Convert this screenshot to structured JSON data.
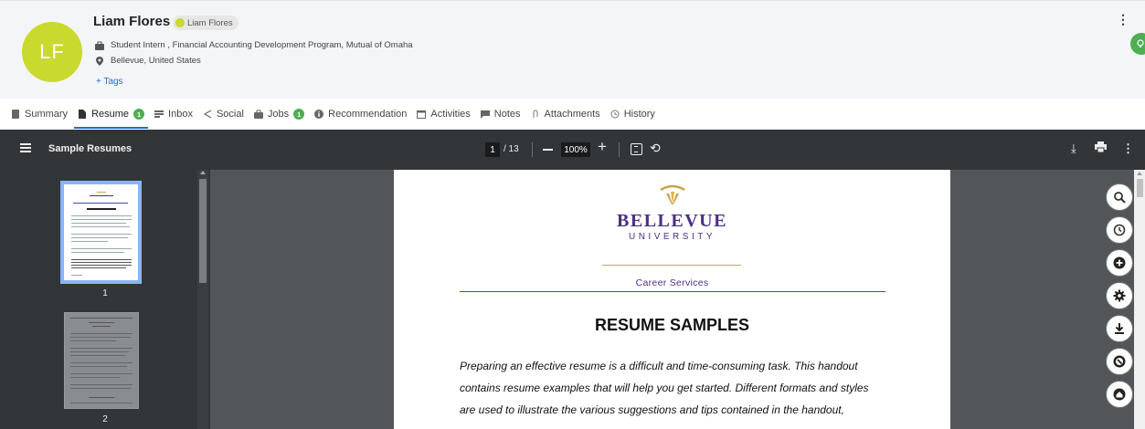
{
  "profile": {
    "initials": "LF",
    "name": "Liam Flores",
    "chip_label": "Liam Flores",
    "position": "Student Intern , Financial Accounting Development Program, Mutual of Omaha",
    "location": "Bellevue, United States",
    "tags_label": "+ Tags",
    "more_menu": "⋮",
    "avatar_color": "#c9d92e"
  },
  "tabs": [
    {
      "label": "Summary",
      "icon": "document-icon"
    },
    {
      "label": "Resume",
      "icon": "file-icon",
      "badge": "1",
      "active": true
    },
    {
      "label": "Inbox",
      "icon": "inbox-icon"
    },
    {
      "label": "Social",
      "icon": "share-icon"
    },
    {
      "label": "Jobs",
      "icon": "briefcase-icon",
      "badge": "1"
    },
    {
      "label": "Recommendation",
      "icon": "info-icon"
    },
    {
      "label": "Activities",
      "icon": "calendar-icon"
    },
    {
      "label": "Notes",
      "icon": "notes-icon"
    },
    {
      "label": "Attachments",
      "icon": "paperclip-icon"
    },
    {
      "label": "History",
      "icon": "history-icon"
    }
  ],
  "viewer": {
    "doc_title": "Sample Resumes",
    "page_current": "1",
    "page_total": "/ 13",
    "zoom": "100%",
    "thumbnail_labels": [
      "1",
      "2"
    ]
  },
  "document": {
    "logo_line1": "BELLEVUE",
    "logo_line2": "UNIVERSITY",
    "department": "Career Services",
    "heading": "RESUME SAMPLES",
    "paragraph_lines": [
      "Preparing an effective resume is a difficult and time-consuming task.  This handout",
      "contains resume examples that will help you get started.  Different formats and styles",
      "are used to illustrate the various suggestions and tips contained in the handout,"
    ]
  },
  "colors": {
    "accent": "#1f6fc9",
    "badge_green": "#4caf50",
    "brand_purple": "#4b2e83",
    "brand_gold": "#caa548"
  }
}
